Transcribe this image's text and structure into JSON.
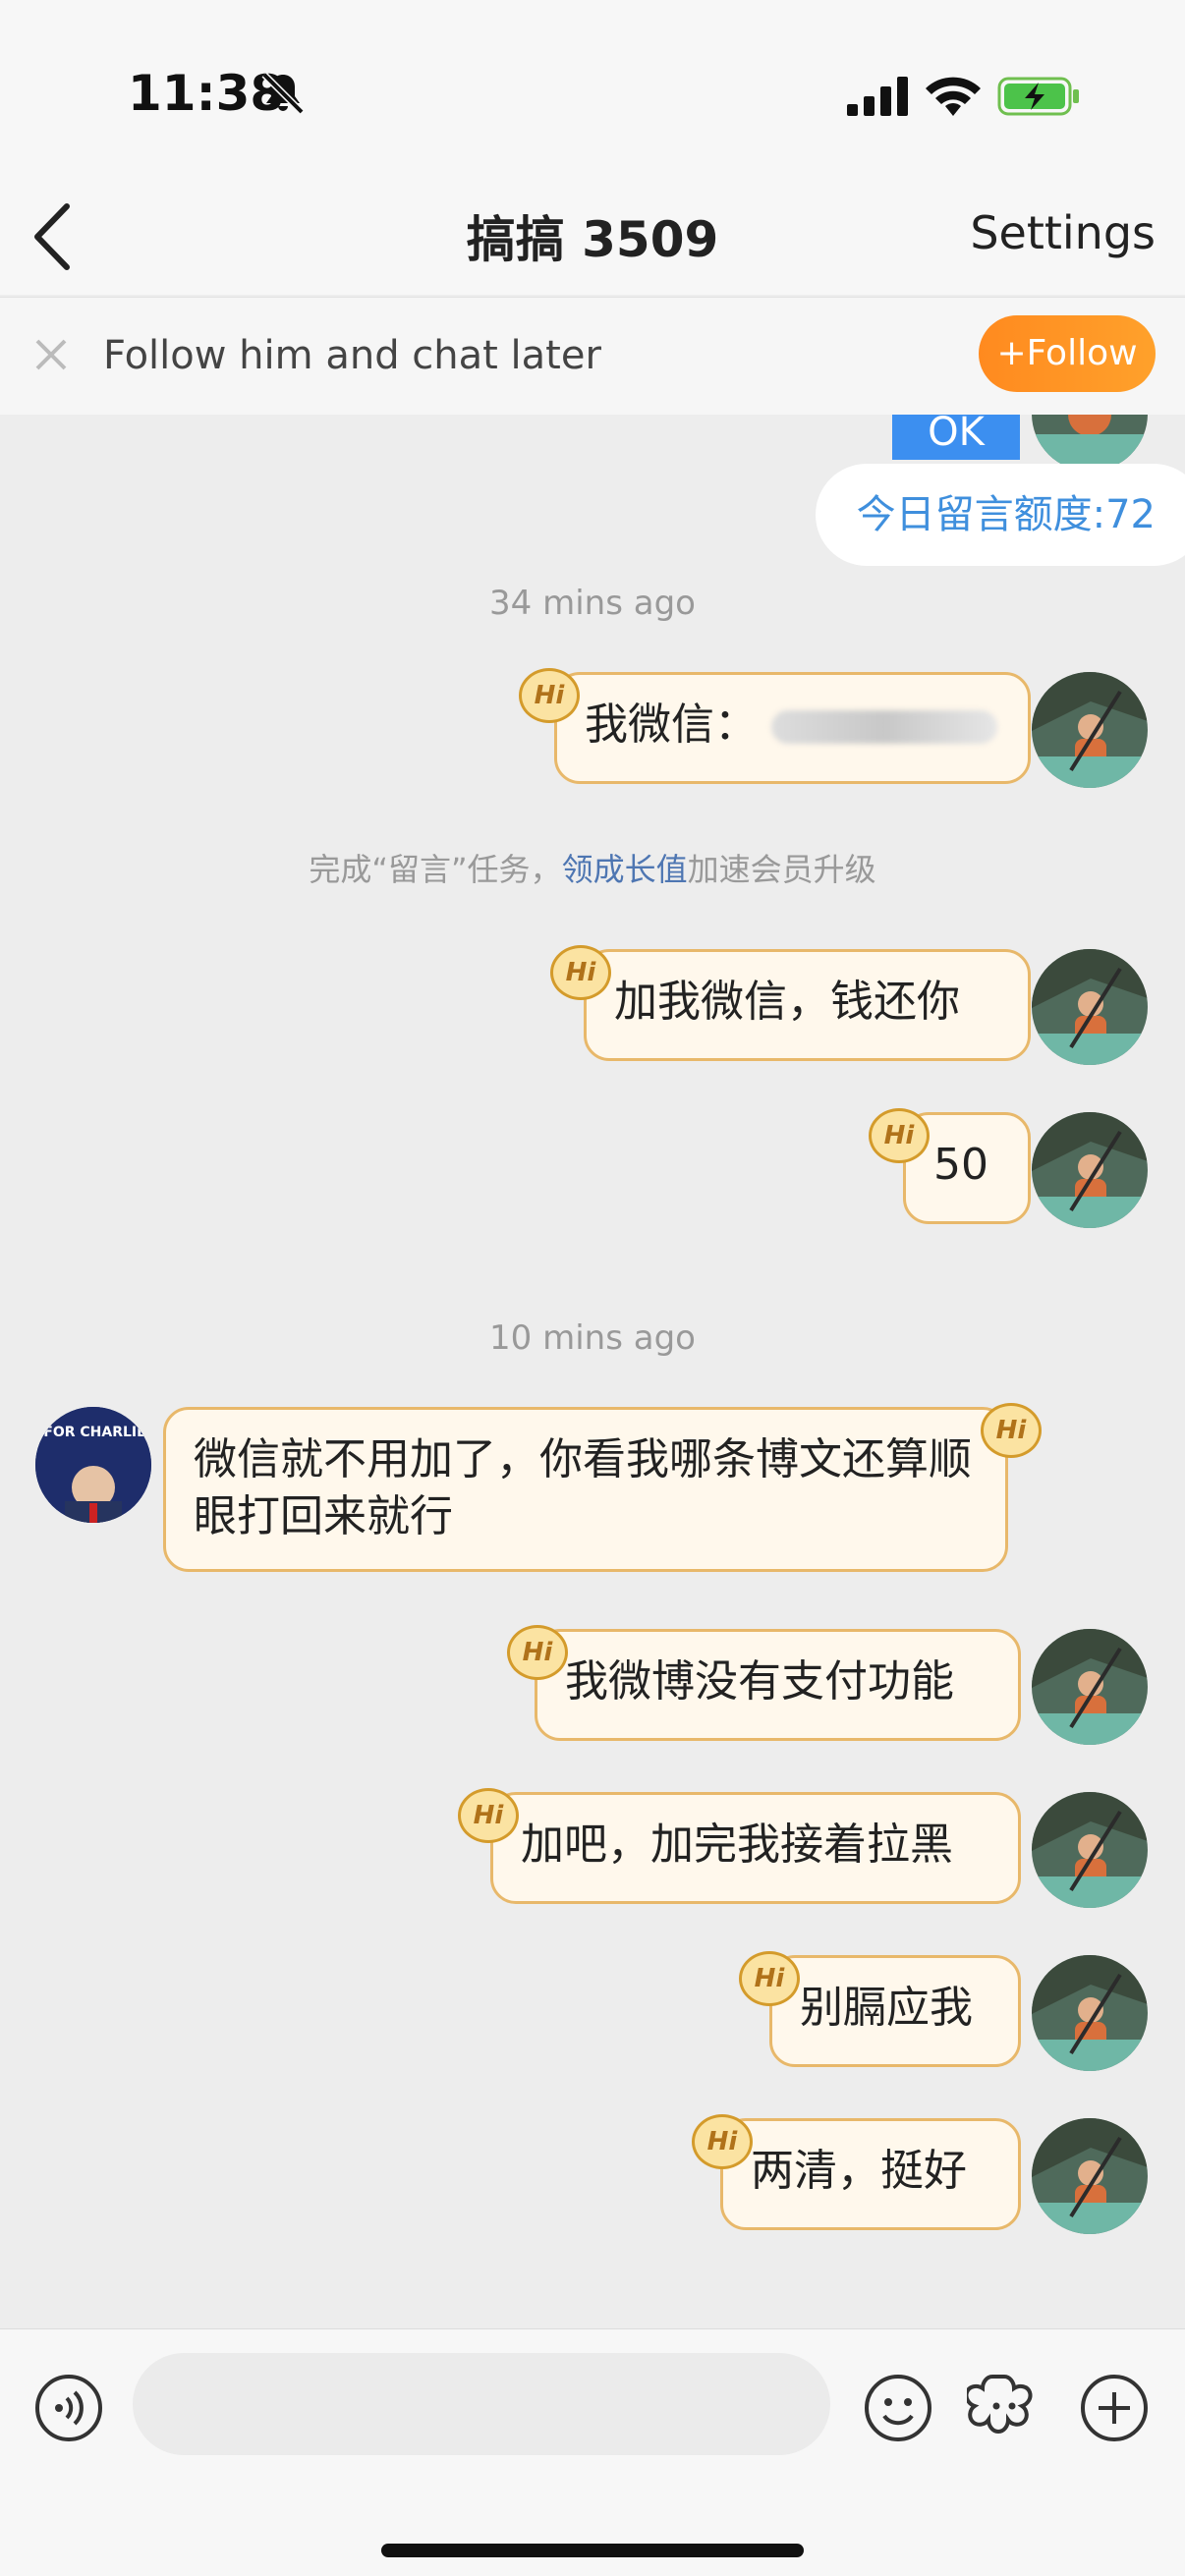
{
  "status_bar": {
    "time": "11:38",
    "icons": [
      "bell-slash-icon",
      "signal-icon",
      "wifi-icon",
      "battery-charging-icon"
    ]
  },
  "nav": {
    "title": "搞搞 3509",
    "settings_label": "Settings"
  },
  "follow_banner": {
    "text": "Follow him and chat later",
    "follow_label": "+Follow"
  },
  "ok_tag": "OK",
  "quota_text": "今日留言额度:72",
  "hi_badge": "Hi",
  "messages": [
    {
      "type": "timestamp",
      "text": "34 mins ago"
    },
    {
      "type": "outgoing",
      "text": "我微信："
    },
    {
      "type": "system",
      "pre": "完成“留言”任务，",
      "link": "领成长值",
      "post": "加速会员升级"
    },
    {
      "type": "outgoing",
      "text": "加我微信，钱还你"
    },
    {
      "type": "outgoing",
      "text": "50"
    },
    {
      "type": "timestamp",
      "text": "10 mins ago"
    },
    {
      "type": "incoming",
      "text": "微信就不用加了，你看我哪条博文还算顺眼打回来就行",
      "avatar_text": "PRAY FOR CHARLIE KIRK"
    },
    {
      "type": "outgoing",
      "text": "我微博没有支付功能"
    },
    {
      "type": "outgoing",
      "text": "加吧，加完我接着拉黑"
    },
    {
      "type": "outgoing",
      "text": "别膈应我"
    },
    {
      "type": "outgoing",
      "text": "两清，挺好"
    }
  ],
  "bottom_bar": {
    "icons": [
      "voice-icon",
      "emoji-icon",
      "sticker-flower-icon",
      "plus-icon"
    ],
    "input_placeholder": ""
  },
  "colors": {
    "accent_orange": "#ff9a24",
    "link_blue": "#4e76b2",
    "quota_blue": "#3f8fdd",
    "bubble_bg": "#fff8ec",
    "bubble_border": "#e8b86a"
  }
}
